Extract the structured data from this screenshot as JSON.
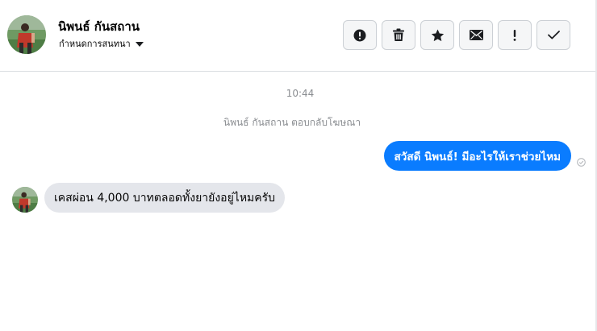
{
  "header": {
    "contact_name": "นิพนธ์ กันสถาน",
    "conversation_menu_label": "กำหนดการสนทนา",
    "toolbar": [
      {
        "name": "report-button",
        "icon": "alert-circle-icon"
      },
      {
        "name": "delete-button",
        "icon": "trash-icon"
      },
      {
        "name": "star-button",
        "icon": "star-icon"
      },
      {
        "name": "mark-unread-button",
        "icon": "envelope-icon"
      },
      {
        "name": "important-button",
        "icon": "exclamation-icon"
      },
      {
        "name": "done-button",
        "icon": "check-icon"
      }
    ]
  },
  "conversation": {
    "timestamp": "10:44",
    "event_note": "นิพนธ์ กันสถาน ตอบกลับโฆษณา",
    "messages": [
      {
        "direction": "outgoing",
        "text": "สวัสดี นิพนธ์! มีอะไรให้เราช่วยไหม",
        "status_icon": "sent-check-icon"
      },
      {
        "direction": "incoming",
        "text": "เคสผ่อน 4,000 บาทตลอดทั้งยายังอยู่ไหมครับ"
      }
    ]
  },
  "colors": {
    "outgoing_bubble": "#0a7cff",
    "incoming_bubble": "#e4e6eb",
    "muted_text": "#8a8d91",
    "button_bg": "#f5f6f7",
    "button_border": "#ccd0d5",
    "divider": "#dadde1"
  }
}
